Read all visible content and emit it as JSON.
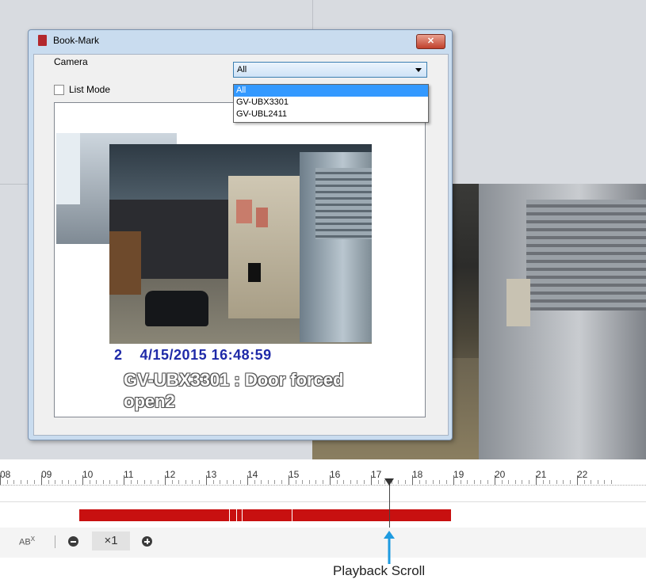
{
  "dialog": {
    "title": "Book-Mark",
    "close_label": "✕",
    "camera_label": "Camera",
    "camera_selected": "All",
    "camera_options": [
      "All",
      "GV-UBX3301",
      "GV-UBL2411"
    ],
    "list_mode_label": "List Mode",
    "bookmark": {
      "channel": "2",
      "timestamp": "4/15/2015 16:48:59",
      "event": "GV-UBX3301 : Door forced open2"
    }
  },
  "timeline": {
    "hours": [
      "08",
      "09",
      "10",
      "11",
      "12",
      "13",
      "14",
      "15",
      "16",
      "17",
      "18",
      "19",
      "20",
      "21",
      "22"
    ],
    "recording_color": "#c81010"
  },
  "toolbar": {
    "ab_label": "AB",
    "ab_sup": "X",
    "speed_label": "×1"
  },
  "annotation": {
    "label": "Playback Scroll",
    "color": "#1e9be0"
  }
}
